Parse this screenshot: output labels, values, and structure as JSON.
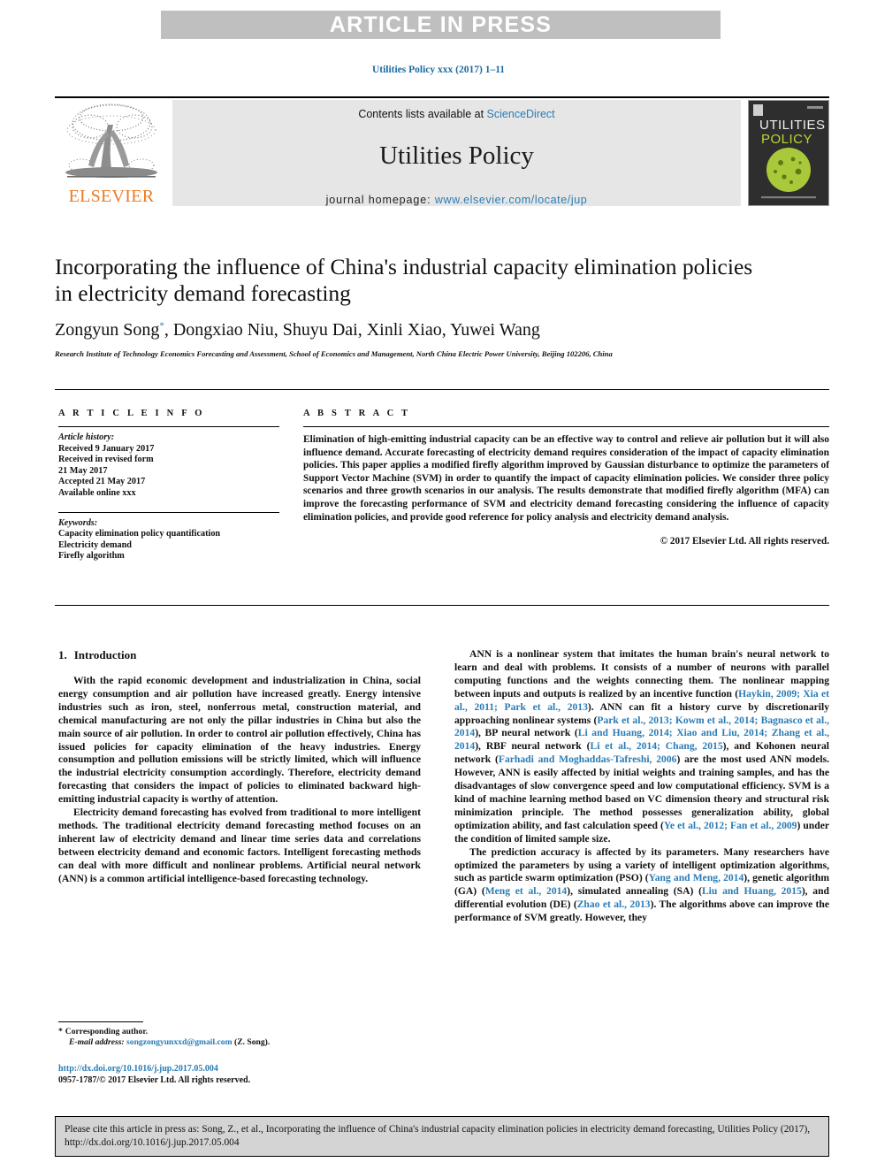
{
  "banner": {
    "text": "ARTICLE IN PRESS"
  },
  "citation_header": "Utilities Policy xxx (2017) 1–11",
  "masthead": {
    "contents_prefix": "Contents lists available at ",
    "sciencedirect": "ScienceDirect",
    "journal_name": "Utilities Policy",
    "homepage_prefix": "journal homepage: ",
    "homepage_url": "www.elsevier.com/locate/jup",
    "publisher": "ELSEVIER",
    "cover_line1": "UTILITIES",
    "cover_line2": "POLICY"
  },
  "article": {
    "title": "Incorporating the influence of China's industrial capacity elimination policies in electricity demand forecasting",
    "authors": "Zongyun Song",
    "author_marker": "*",
    "authors_rest": ", Dongxiao Niu, Shuyu Dai, Xinli Xiao, Yuwei Wang",
    "affiliation": "Research Institute of Technology Economics Forecasting and Assessment, School of Economics and Management, North China Electric Power University, Beijing 102206, China"
  },
  "info": {
    "heading": "A R T I C L E   I N F O",
    "history_label": "Article history:",
    "history_lines": [
      "Received 9 January 2017",
      "Received in revised form",
      "21 May 2017",
      "Accepted 21 May 2017",
      "Available online xxx"
    ],
    "keywords_label": "Keywords:",
    "keywords": [
      "Capacity elimination policy quantification",
      "Electricity demand",
      "Firefly algorithm"
    ]
  },
  "abstract": {
    "heading": "A B S T R A C T",
    "text": "Elimination of high-emitting industrial capacity can be an effective way to control and relieve air pollution but it will also influence demand. Accurate forecasting of electricity demand requires consideration of the impact of capacity elimination policies. This paper applies a modified firefly algorithm improved by Gaussian disturbance to optimize the parameters of Support Vector Machine (SVM) in order to quantify the impact of capacity elimination policies. We consider three policy scenarios and three growth scenarios in our analysis. The results demonstrate that modified firefly algorithm (MFA) can improve the forecasting performance of SVM and electricity demand forecasting considering the influence of capacity elimination policies, and provide good reference for policy analysis and electricity demand analysis.",
    "copyright": "© 2017 Elsevier Ltd. All rights reserved."
  },
  "section": {
    "number": "1.",
    "title": "Introduction"
  },
  "body": {
    "left_p1": "With the rapid economic development and industrialization in China, social energy consumption and air pollution have increased greatly. Energy intensive industries such as iron, steel, nonferrous metal, construction material, and chemical manufacturing are not only the pillar industries in China but also the main source of air pollution. In order to control air pollution effectively, China has issued policies for capacity elimination of the heavy industries. Energy consumption and pollution emissions will be strictly limited, which will influence the industrial electricity consumption accordingly. Therefore, electricity demand forecasting that considers the impact of policies to eliminated backward high-emitting industrial capacity is worthy of attention.",
    "left_p2": "Electricity demand forecasting has evolved from traditional to more intelligent methods. The traditional electricity demand forecasting method focuses on an inherent law of electricity demand and linear time series data and correlations between electricity demand and economic factors. Intelligent forecasting methods can deal with more difficult and nonlinear problems. Artificial neural network (ANN) is a common artificial intelligence-based forecasting technology.",
    "right_p1_a": "ANN is a nonlinear system that imitates the human brain's neural network to learn and deal with problems. It consists of a number of neurons with parallel computing functions and the weights connecting them. The nonlinear mapping between inputs and outputs is realized by an incentive function (",
    "right_p1_ref1": "Haykin, 2009; Xia et al., 2011; Park et al., 2013",
    "right_p1_b": "). ANN can fit a history curve by discretionarily approaching nonlinear systems (",
    "right_p1_ref2": "Park et al., 2013; Kowm et al., 2014; Bagnasco et al., 2014",
    "right_p1_c": "), BP neural network (",
    "right_p1_ref3": "Li and Huang, 2014; Xiao and Liu, 2014; Zhang et al., 2014",
    "right_p1_d": "), RBF neural network (",
    "right_p1_ref4": "Li et al., 2014; Chang, 2015",
    "right_p1_e": "), and Kohonen neural network (",
    "right_p1_ref5": "Farhadi and Moghaddas-Tafreshi, 2006",
    "right_p1_f": ") are the most used ANN models. However, ANN is easily affected by initial weights and training samples, and has the disadvantages of slow convergence speed and low computational efficiency. SVM is a kind of machine learning method based on VC dimension theory and structural risk minimization principle. The method possesses generalization ability, global optimization ability, and fast calculation speed (",
    "right_p1_ref6": "Ye et al., 2012; Fan et al., 2009",
    "right_p1_g": ") under the condition of limited sample size.",
    "right_p2_a": "The prediction accuracy is affected by its parameters. Many researchers have optimized the parameters by using a variety of intelligent optimization algorithms, such as particle swarm optimization (PSO) (",
    "right_p2_ref1": "Yang and Meng, 2014",
    "right_p2_b": "), genetic algorithm (GA) (",
    "right_p2_ref2": "Meng et al., 2014",
    "right_p2_c": "), simulated annealing (SA) (",
    "right_p2_ref3": "Liu and Huang, 2015",
    "right_p2_d": "), and differential evolution (DE) (",
    "right_p2_ref4": "Zhao et al., 2013",
    "right_p2_e": "). The algorithms above can improve the performance of SVM greatly. However, they"
  },
  "footnote": {
    "star": "*",
    "corresponding": "Corresponding author.",
    "email_label": "E-mail address:",
    "email": "songzongyunxxd@gmail.com",
    "email_suffix": "(Z. Song).",
    "doi": "http://dx.doi.org/10.1016/j.jup.2017.05.004",
    "issn": "0957-1787/© 2017 Elsevier Ltd. All rights reserved."
  },
  "cite_footer": {
    "text": "Please cite this article in press as: Song, Z., et al., Incorporating the influence of China's industrial capacity elimination policies in electricity demand forecasting, Utilities Policy (2017), http://dx.doi.org/10.1016/j.jup.2017.05.004"
  },
  "colors": {
    "link": "#2a7cb5",
    "banner_bg": "#bfbfbf",
    "masthead_bg": "#e6e6e6",
    "elsevier_orange": "#ec7b25"
  }
}
